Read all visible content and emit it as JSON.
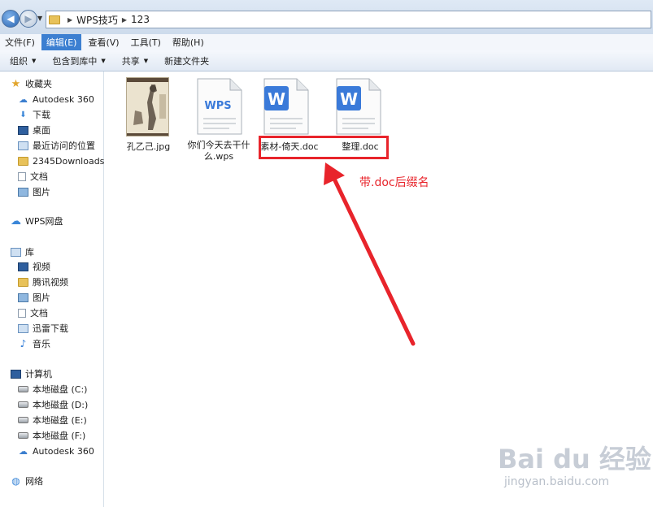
{
  "address": {
    "breadcrumb": [
      "WPS技巧",
      "123"
    ]
  },
  "menubar": {
    "items": [
      "文件(F)",
      "编辑(E)",
      "查看(V)",
      "工具(T)",
      "帮助(H)"
    ],
    "active": "编辑(E)"
  },
  "commandbar": {
    "organize": "组织",
    "include_in_library": "包含到库中",
    "share": "共享",
    "new_folder": "新建文件夹"
  },
  "nav": {
    "favorites": {
      "title": "收藏夹",
      "items": [
        "Autodesk 360",
        "下载",
        "桌面",
        "最近访问的位置",
        "2345Downloads",
        "文档",
        "图片"
      ]
    },
    "wps_cloud": "WPS网盘",
    "libraries": {
      "title": "库",
      "items": [
        "视频",
        "腾讯视频",
        "图片",
        "文档",
        "迅雷下载",
        "音乐"
      ]
    },
    "computer": {
      "title": "计算机",
      "items": [
        "本地磁盘 (C:)",
        "本地磁盘 (D:)",
        "本地磁盘 (E:)",
        "本地磁盘 (F:)",
        "Autodesk 360"
      ]
    },
    "network": "网络"
  },
  "files": [
    {
      "name": "孔乙己.jpg",
      "type": "image"
    },
    {
      "name": "你们今天去干什么.wps",
      "type": "wps",
      "icon_text": "WPS"
    },
    {
      "name": "素材-倚天.doc",
      "type": "doc",
      "icon_text": "W"
    },
    {
      "name": "整理.doc",
      "type": "doc",
      "icon_text": "W"
    }
  ],
  "annotation": {
    "text": "带.doc后缀名",
    "color": "#e8242b"
  },
  "watermark": {
    "main": "Bai du 经验",
    "sub": "jingyan.baidu.com"
  },
  "colors": {
    "wps_blue": "#3a7ad9",
    "menu_active": "#3c7fd1",
    "highlight_red": "#e8242b"
  }
}
